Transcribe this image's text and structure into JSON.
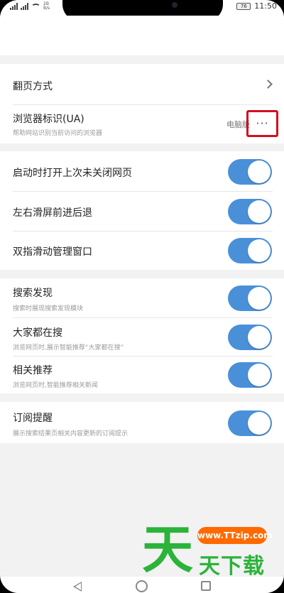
{
  "status": {
    "speed_top": "2B",
    "speed_bottom": "B/s",
    "battery": "76",
    "time": "11:50"
  },
  "rows": {
    "page_turn": {
      "label": "翻页方式"
    },
    "ua": {
      "label": "浏览器标识(UA)",
      "sub": "帮助网站识别当前访问的浏览器",
      "value": "电脑版",
      "more": "···"
    },
    "restore_pages": {
      "label": "启动时打开上次未关闭网页",
      "on": true
    },
    "swipe_nav": {
      "label": "左右滑屏前进后退",
      "on": true
    },
    "two_finger": {
      "label": "双指滑动管理窗口",
      "on": true
    },
    "search_discover": {
      "label": "搜索发现",
      "sub": "搜索时展现搜索发现模块",
      "on": true
    },
    "everyone_search": {
      "label": "大家都在搜",
      "sub": "浏览网页时,展示智能推荐“大家都在搜”",
      "on": true
    },
    "related": {
      "label": "相关推荐",
      "sub": "浏览网页时,智能推荐相关新闻",
      "on": true
    },
    "subscribe": {
      "label": "订阅提醒",
      "sub": "展示搜索结果页相关内容更新的订阅提示",
      "on": true
    }
  },
  "watermark": {
    "big": "天",
    "url": "www.TTzip.com",
    "text": "天下载"
  },
  "colors": {
    "toggle_on": "#4a90d9",
    "highlight": "#d10f1f",
    "watermark_green": "#2bb33a",
    "watermark_orange": "#ff6a00"
  },
  "icons": {
    "chevron": "chevron-right-icon",
    "more": "more-dots-icon",
    "back": "back-triangle-icon",
    "home": "home-circle-icon",
    "recent": "recent-square-icon"
  }
}
